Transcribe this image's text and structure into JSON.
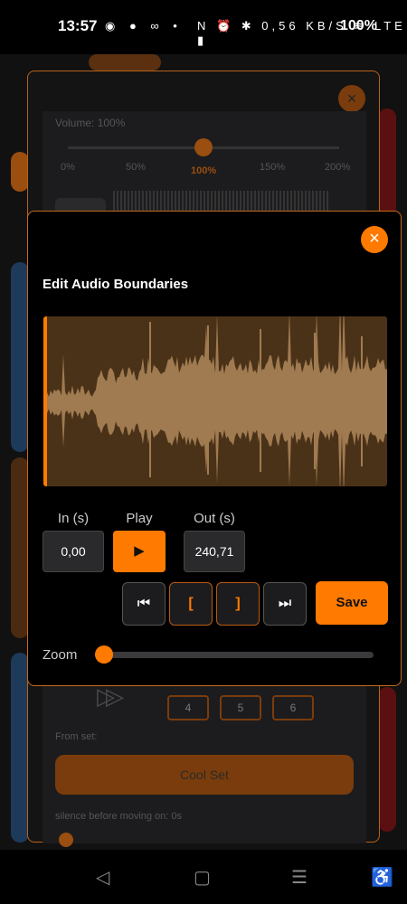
{
  "status_bar": {
    "time": "13:57",
    "left_icons": "◉ ● ∞ •",
    "right_icons": "N ⏰ ✱ 0,56 KB/S ≋ LTE ▮",
    "battery": "100%"
  },
  "background_modal": {
    "volume_label": "Volume: 100%",
    "volume_ticks": [
      "0%",
      "50%",
      "100%",
      "150%",
      "200%"
    ],
    "number_buttons": [
      "4",
      "5",
      "6"
    ],
    "from_set_label": "From set:",
    "cool_set_label": "Cool Set",
    "silence_label": "silence before moving on: 0s",
    "close_icon": "×"
  },
  "modal": {
    "title": "Edit Audio Boundaries",
    "close_icon": "×",
    "in_label": "In (s)",
    "in_value": "0,00",
    "play_label": "Play",
    "play_icon": "▶",
    "out_label": "Out (s)",
    "out_value": "240,71",
    "skip_start_icon": "⏮",
    "set_in_icon": "[",
    "set_out_icon": "]",
    "skip_end_icon": "⏭",
    "save_label": "Save",
    "zoom_label": "Zoom",
    "zoom_level": 0.0
  },
  "nav_bar": {
    "back_icon": "◁",
    "home_icon": "▢",
    "recents_icon": "☰",
    "accessibility_icon": "♿"
  },
  "colors": {
    "accent": "#ff7a00",
    "waveform_bg": "#4a3218",
    "waveform_fg": "#a07a50"
  }
}
